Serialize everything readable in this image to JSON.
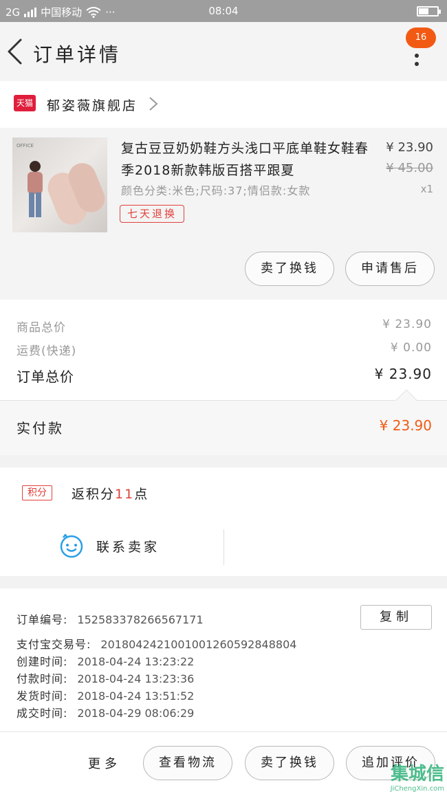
{
  "status_bar": {
    "signal": "2G",
    "carrier": "中国移动",
    "dots": "···",
    "time": "08:04"
  },
  "header": {
    "title": "订单详情",
    "badge": "16"
  },
  "store": {
    "logo": "天猫",
    "name": "郁姿薇旗舰店"
  },
  "product": {
    "image_caption": "OFFICE",
    "title": "复古豆豆奶奶鞋方头浅口平底单鞋女鞋春季2018新款韩版百搭平跟夏",
    "spec": "颜色分类:米色;尺码:37;情侣款:女款",
    "price": "¥ 23.90",
    "original_price": "¥ 45.00",
    "quantity": "x1",
    "tag": "七天退换",
    "btn_repurchase": "卖了换钱",
    "btn_after_sale": "申请售后"
  },
  "summary": {
    "goods_total_label": "商品总价",
    "goods_total_value": "¥ 23.90",
    "shipping_label": "运费(快递)",
    "shipping_value": "¥ 0.00",
    "order_total_label": "订单总价",
    "order_total_value": "¥ 23.90",
    "paid_label": "实付款",
    "paid_value": "¥ 23.90"
  },
  "points": {
    "tag": "积分",
    "text_prefix": "返积分",
    "value": "11",
    "text_suffix": "点"
  },
  "contact": {
    "label": "联系卖家"
  },
  "order_info": {
    "copy_button": "复制",
    "rows": [
      {
        "label": "订单编号:",
        "value": "152583378266567171"
      },
      {
        "label": "支付宝交易号:",
        "value": "2018042421001001260592848804"
      },
      {
        "label": "创建时间:",
        "value": "2018-04-24 13:23:22"
      },
      {
        "label": "付款时间:",
        "value": "2018-04-24 13:23:36"
      },
      {
        "label": "发货时间:",
        "value": "2018-04-24 13:51:52"
      },
      {
        "label": "成交时间:",
        "value": "2018-04-29 08:06:29"
      }
    ]
  },
  "footer": {
    "more": "更多",
    "btn_logistics": "查看物流",
    "btn_sell": "卖了换钱",
    "btn_review": "追加评价"
  },
  "watermark": {
    "logo": "集城信",
    "url": "JiChengXin.com"
  },
  "colors": {
    "accent": "#f25a14",
    "tmall_red": "#e01e3c",
    "tag_red": "#e0403a",
    "contact_blue": "#2a9fe6"
  }
}
